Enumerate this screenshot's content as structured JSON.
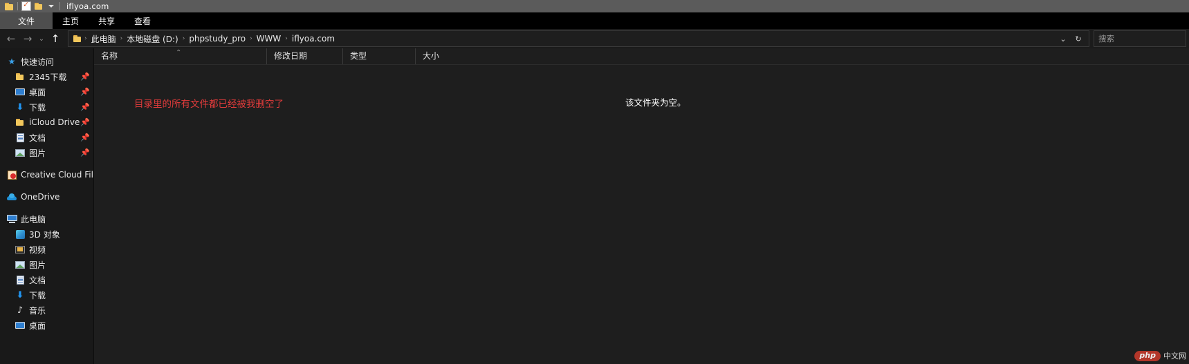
{
  "window": {
    "title": "iflyoa.com"
  },
  "quick_access_toolbar": {
    "items": [
      {
        "name": "folder-icon",
        "label": ""
      },
      {
        "name": "properties-icon",
        "label": ""
      },
      {
        "name": "new-folder-icon",
        "label": ""
      },
      {
        "name": "customize-chevron-icon",
        "label": ""
      }
    ]
  },
  "ribbon": {
    "tabs": [
      {
        "label": "文件",
        "active": true
      },
      {
        "label": "主页",
        "active": false
      },
      {
        "label": "共享",
        "active": false
      },
      {
        "label": "查看",
        "active": false
      }
    ]
  },
  "address_bar": {
    "back_label": "←",
    "forward_label": "→",
    "recent_label": "⌄",
    "up_label": "↑",
    "breadcrumbs": [
      {
        "label": "此电脑"
      },
      {
        "label": "本地磁盘 (D:)"
      },
      {
        "label": "phpstudy_pro"
      },
      {
        "label": "WWW"
      },
      {
        "label": "iflyoa.com"
      }
    ],
    "separator": "›",
    "history_chevron": "⌄",
    "refresh_icon": "↻",
    "search_placeholder": "搜索"
  },
  "sidebar": {
    "groups": [
      {
        "header": {
          "label": "快速访问",
          "icon": "star-icon"
        },
        "items": [
          {
            "label": "2345下载",
            "icon": "folder-icon",
            "pinned": true
          },
          {
            "label": "桌面",
            "icon": "desktop-icon",
            "pinned": true
          },
          {
            "label": "下载",
            "icon": "download-icon",
            "pinned": true
          },
          {
            "label": "iCloud Drive",
            "icon": "folder-icon",
            "pinned": true
          },
          {
            "label": "文档",
            "icon": "documents-icon",
            "pinned": true
          },
          {
            "label": "图片",
            "icon": "pictures-icon",
            "pinned": true
          }
        ]
      },
      {
        "header": {
          "label": "Creative Cloud Files",
          "icon": "creative-cloud-icon"
        },
        "items": []
      },
      {
        "header": {
          "label": "OneDrive",
          "icon": "onedrive-icon"
        },
        "items": []
      },
      {
        "header": {
          "label": "此电脑",
          "icon": "this-pc-icon"
        },
        "items": [
          {
            "label": "3D 对象",
            "icon": "3d-objects-icon",
            "pinned": false
          },
          {
            "label": "视频",
            "icon": "videos-icon",
            "pinned": false
          },
          {
            "label": "图片",
            "icon": "pictures-icon",
            "pinned": false
          },
          {
            "label": "文档",
            "icon": "documents-icon",
            "pinned": false
          },
          {
            "label": "下载",
            "icon": "download-icon",
            "pinned": false
          },
          {
            "label": "音乐",
            "icon": "music-icon",
            "pinned": false
          },
          {
            "label": "桌面",
            "icon": "desktop-icon",
            "pinned": false
          }
        ]
      }
    ],
    "pin_glyph": "📌"
  },
  "file_list": {
    "columns": [
      {
        "label": "名称",
        "sorted": true,
        "sort_glyph": "⌃"
      },
      {
        "label": "修改日期",
        "sorted": false,
        "sort_glyph": ""
      },
      {
        "label": "类型",
        "sorted": false,
        "sort_glyph": ""
      },
      {
        "label": "大小",
        "sorted": false,
        "sort_glyph": ""
      }
    ],
    "rows": [],
    "empty_message": "该文件夹为空。",
    "annotation": "目录里的所有文件都已经被我删空了",
    "annotation_color": "#e03b3b"
  },
  "watermark": {
    "badge": "php",
    "text": "中文网"
  }
}
